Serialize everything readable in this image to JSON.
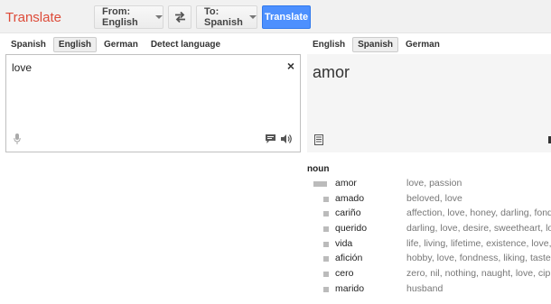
{
  "header": {
    "title": "Translate",
    "from_label": "From: English",
    "to_label": "To: Spanish",
    "translate_label": "Translate"
  },
  "source_langs": [
    "Spanish",
    "English",
    "German",
    "Detect language"
  ],
  "source_active": "English",
  "target_langs": [
    "English",
    "Spanish",
    "German"
  ],
  "target_active": "Spanish",
  "source": {
    "text": "love",
    "clear": "×"
  },
  "result": {
    "text": "amor"
  },
  "dictionary": {
    "part_of_speech": "noun",
    "entries": [
      {
        "term": "amor",
        "synonyms": "love, passion",
        "frequency": "high"
      },
      {
        "term": "amado",
        "synonyms": "beloved, love",
        "frequency": "low"
      },
      {
        "term": "cariño",
        "synonyms": "affection, love, honey, darling, fondness",
        "frequency": "low"
      },
      {
        "term": "querido",
        "synonyms": "darling, love, desire, sweetheart, love",
        "frequency": "low"
      },
      {
        "term": "vida",
        "synonyms": "life, living, lifetime, existence, love, li",
        "frequency": "low"
      },
      {
        "term": "afición",
        "synonyms": "hobby, love, fondness, liking, taste, p",
        "frequency": "low"
      },
      {
        "term": "cero",
        "synonyms": "zero, nil, nothing, naught, love, cipher",
        "frequency": "low"
      },
      {
        "term": "marido",
        "synonyms": "husband",
        "frequency": "low"
      }
    ]
  },
  "colors": {
    "brand": "#dd4b39",
    "primary_button": "#4d90fe"
  }
}
